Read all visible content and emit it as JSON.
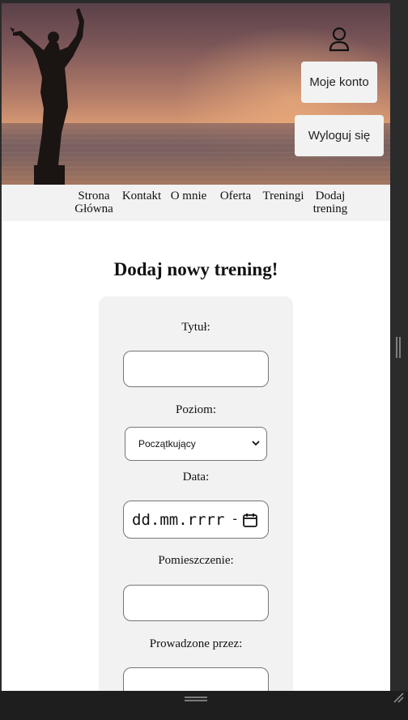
{
  "header": {
    "account_button": "Moje konto",
    "logout_button": "Wyloguj się"
  },
  "nav": {
    "items": [
      {
        "line1": "Strona",
        "line2": "Główna"
      },
      {
        "line1": "Kontakt",
        "line2": ""
      },
      {
        "line1": "O mnie",
        "line2": ""
      },
      {
        "line1": "Oferta",
        "line2": ""
      },
      {
        "line1": "Treningi",
        "line2": ""
      },
      {
        "line1": "Dodaj",
        "line2": "trening"
      }
    ]
  },
  "form": {
    "title": "Dodaj nowy trening!",
    "title_label": "Tytuł:",
    "title_value": "",
    "level_label": "Poziom:",
    "level_selected": "Początkujący",
    "date_label": "Data:",
    "date_placeholder": "dd.mm.rrrr",
    "room_label": "Pomieszczenie:",
    "room_value": "",
    "trainer_label": "Prowadzone przez:",
    "trainer_value": ""
  },
  "colors": {
    "nav_bg": "#f2f2f2",
    "card_bg": "#f2f2f2",
    "chrome_bg": "#2b2b2b"
  }
}
